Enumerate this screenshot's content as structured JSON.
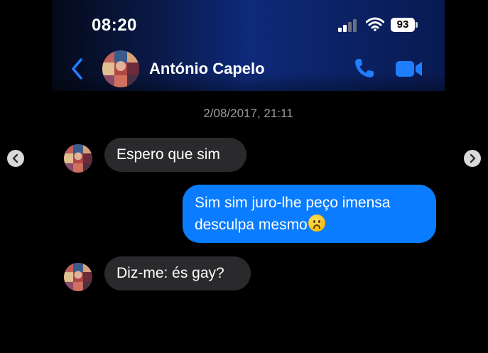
{
  "status_bar": {
    "time": "08:20",
    "battery": "93"
  },
  "chat_header": {
    "contact_name": "António Capelo"
  },
  "conversation": {
    "timestamp": "2/08/2017, 21:11",
    "messages": [
      {
        "direction": "incoming",
        "text": "Espero que sim"
      },
      {
        "direction": "outgoing",
        "line1": "Sim sim juro-lhe peço imensa",
        "line2": "desculpa mesmo",
        "emoji": "frowning-face-icon"
      },
      {
        "direction": "incoming",
        "text": "Diz-me: és gay?"
      }
    ]
  },
  "colors": {
    "accent": "#0a7cff",
    "incoming_bubble": "#2a2a2d",
    "background": "#000000"
  }
}
